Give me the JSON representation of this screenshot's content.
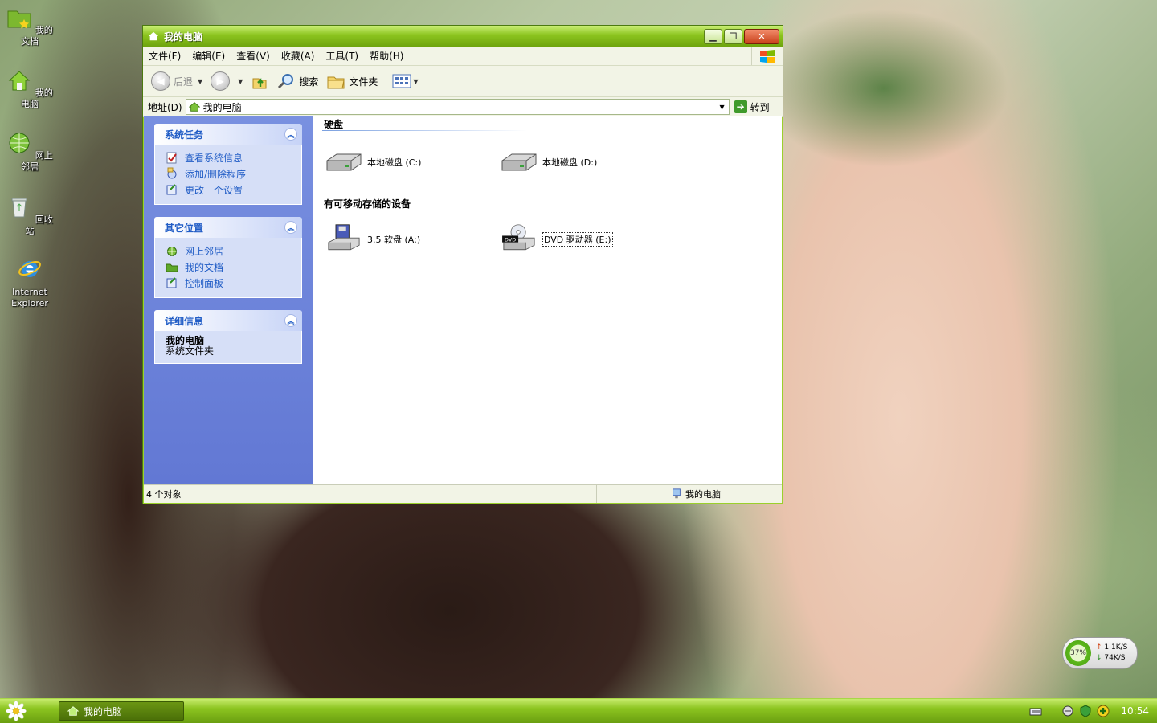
{
  "desktop": {
    "icons": [
      {
        "label": "我的文档"
      },
      {
        "label": "我的电脑"
      },
      {
        "label": "网上邻居"
      },
      {
        "label": "回收站"
      },
      {
        "label": "Internet Explorer"
      }
    ]
  },
  "window": {
    "title": "我的电脑",
    "menu": [
      "文件(F)",
      "编辑(E)",
      "查看(V)",
      "收藏(A)",
      "工具(T)",
      "帮助(H)"
    ],
    "toolbar": {
      "back": "后退",
      "search": "搜索",
      "folders": "文件夹"
    },
    "address": {
      "label": "地址(D)",
      "value": "我的电脑",
      "go": "转到"
    },
    "sidebar": {
      "system_tasks": {
        "title": "系统任务",
        "items": [
          "查看系统信息",
          "添加/删除程序",
          "更改一个设置"
        ]
      },
      "other_places": {
        "title": "其它位置",
        "items": [
          "网上邻居",
          "我的文档",
          "控制面板"
        ]
      },
      "details": {
        "title": "详细信息",
        "name": "我的电脑",
        "desc": "系统文件夹"
      }
    },
    "content": {
      "hard_disks": {
        "title": "硬盘",
        "items": [
          "本地磁盘 (C:)",
          "本地磁盘 (D:)"
        ]
      },
      "removable": {
        "title": "有可移动存储的设备",
        "items": [
          "3.5 软盘 (A:)",
          "DVD 驱动器 (E:)"
        ]
      }
    },
    "status": {
      "count": "4 个对象",
      "location": "我的电脑"
    }
  },
  "netmon": {
    "percent": "37%",
    "up": "1.1K/S",
    "down": "74K/S"
  },
  "taskbar": {
    "task": "我的电脑",
    "clock": "10:54"
  },
  "colors": {
    "title_green": "#8cc41e",
    "sidebar_blue": "#6278d4",
    "link_blue": "#215dc6"
  }
}
